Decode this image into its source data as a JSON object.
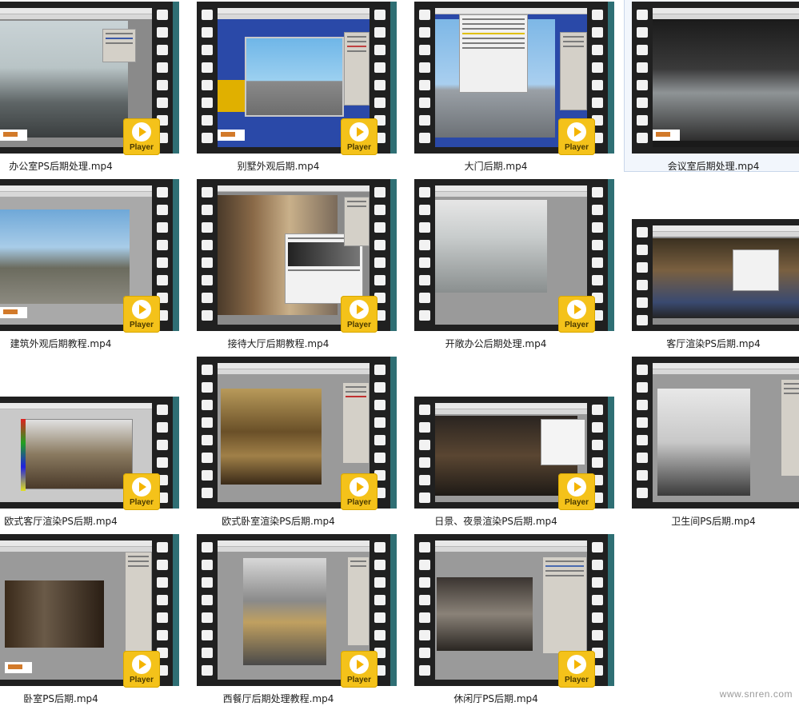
{
  "player_label": "Player",
  "watermark": "www.snren.com",
  "files": [
    {
      "name": "办公室PS后期处理.mp4",
      "selected": false
    },
    {
      "name": "别墅外观后期.mp4",
      "selected": false
    },
    {
      "name": "大门后期.mp4",
      "selected": false
    },
    {
      "name": "会议室后期处理.mp4",
      "selected": true
    },
    {
      "name": "建筑外观后期教程.mp4",
      "selected": false
    },
    {
      "name": "接待大厅后期教程.mp4",
      "selected": false
    },
    {
      "name": "开敞办公后期处理.mp4",
      "selected": false
    },
    {
      "name": "客厅渲染PS后期.mp4",
      "selected": false
    },
    {
      "name": "欧式客厅渲染PS后期.mp4",
      "selected": false
    },
    {
      "name": "欧式卧室渲染PS后期.mp4",
      "selected": false
    },
    {
      "name": "日景、夜景渲染PS后期.mp4",
      "selected": false
    },
    {
      "name": "卫生间PS后期.mp4",
      "selected": false
    },
    {
      "name": "卧室PS后期.mp4",
      "selected": false
    },
    {
      "name": "西餐厅后期处理教程.mp4",
      "selected": false
    },
    {
      "name": "休闲厅PS后期.mp4",
      "selected": false
    }
  ]
}
